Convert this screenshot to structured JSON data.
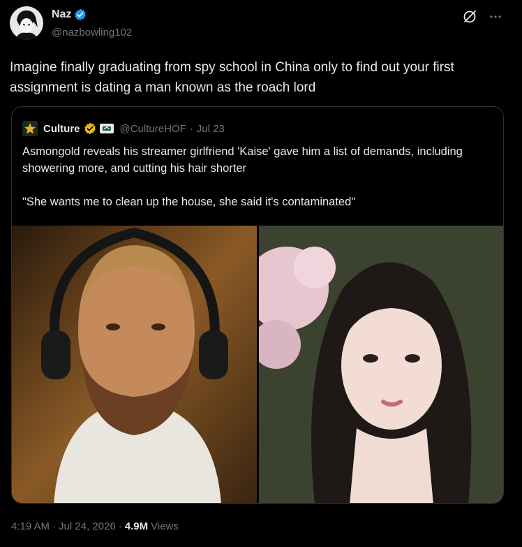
{
  "author": {
    "display_name": "Naz",
    "handle": "@nazbowling102",
    "avatar_icon": "anime-avatar-icon",
    "verified_color": "#1d9bf0"
  },
  "top_icons": [
    "grok-icon",
    "more-icon"
  ],
  "tweet": {
    "text": "Imagine finally graduating from spy school in China only to find out your first assignment is dating a man known as the roach lord"
  },
  "quote": {
    "name": "Culture",
    "handle": "@CultureHOF",
    "separator": "·",
    "date": "Jul 23",
    "badge_color": "#e2b719",
    "paragraphs": [
      "Asmongold reveals his streamer girlfriend 'Kaise' gave him a list of demands, including showering more, and cutting his hair shorter",
      "\"She wants me to clean up the house, she said it's contaminated\""
    ],
    "images": [
      "man-with-headphones-photo",
      "woman-with-bangs-photo"
    ]
  },
  "footer": {
    "time": "4:19 AM",
    "sep1": "·",
    "date": "Jul 24, 2026",
    "sep2": "·",
    "views_count": "4.9M",
    "views_label": "Views"
  }
}
